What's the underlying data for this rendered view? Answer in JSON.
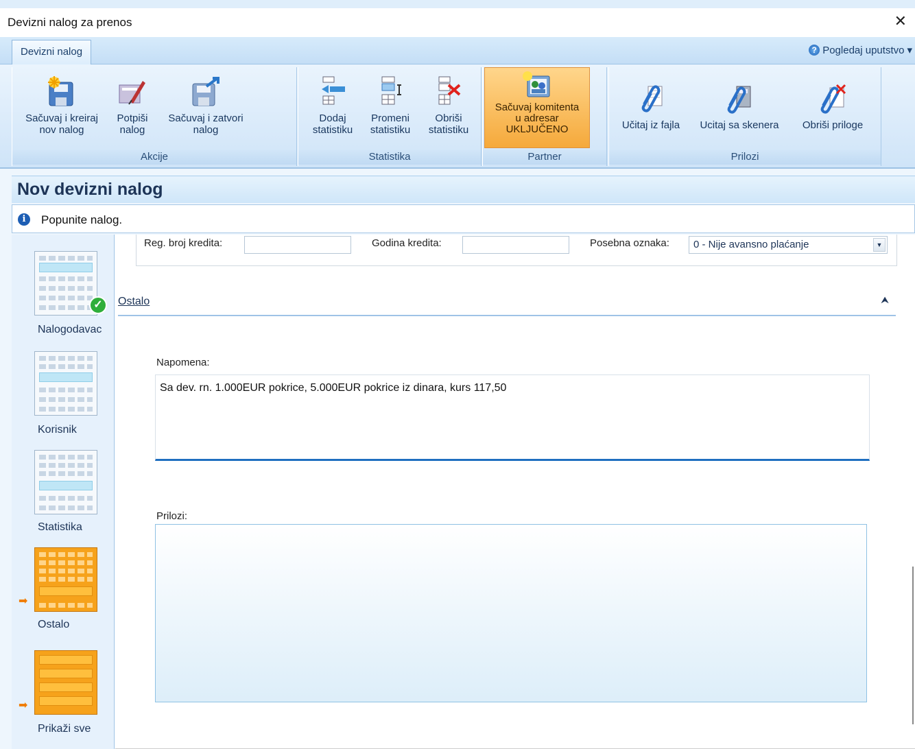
{
  "window": {
    "title": "Devizni nalog za prenos",
    "close": "✕"
  },
  "ribbon_tabs": {
    "active": "Devizni nalog",
    "help": "Pogledaj uputstvo",
    "help_caret": "▾"
  },
  "ribbon": {
    "groups": {
      "akcije": "Akcije",
      "statistika": "Statistika",
      "partner": "Partner",
      "prilozi": "Prilozi"
    },
    "buttons": {
      "save_new": [
        "Sačuvaj i kreiraj",
        "nov nalog"
      ],
      "sign": [
        "Potpiši",
        "nalog"
      ],
      "save_close": [
        "Sačuvaj i zatvori",
        "nalog"
      ],
      "add_stat": [
        "Dodaj",
        "statistiku"
      ],
      "change_stat": [
        "Promeni",
        "statistiku"
      ],
      "delete_stat": [
        "Obriši",
        "statistiku"
      ],
      "save_client": [
        "Sačuvaj komitenta",
        "u adresar",
        "UKLJUČENO"
      ],
      "load_file": "Učitaj iz fajla",
      "load_scanner": "Ucitaj sa skenera",
      "delete_attachments": "Obriši priloge"
    },
    "colors": {
      "accent": "#f5a93b",
      "ribbon_bg": "#cfe4f8"
    }
  },
  "page": {
    "title": "Nov devizni nalog",
    "info": "Popunite nalog."
  },
  "nav": {
    "items": [
      {
        "label": "Nalogodavac",
        "completed": true
      },
      {
        "label": "Korisnik"
      },
      {
        "label": "Statistika"
      },
      {
        "label": "Ostalo",
        "current": true
      },
      {
        "label": "Prikaži sve"
      }
    ],
    "check_glyph": "✓",
    "arrow_glyph": "➡"
  },
  "form": {
    "reg_label": "Reg. broj kredita:",
    "godina_label": "Godina kredita:",
    "posebna_label": "Posebna oznaka:",
    "posebna_value": "0 - Nije avansno plaćanje",
    "combo_caret": "▼",
    "section_title": "Ostalo",
    "collapse_glyph": "⮝",
    "napomena_label": "Napomena:",
    "napomena_value": "Sa dev. rn. 1.000EUR pokrice, 5.000EUR pokrice iz dinara, kurs 117,50",
    "prilozi_label": "Prilozi:"
  },
  "icons": [
    "save-new-icon",
    "sign-icon",
    "save-close-icon",
    "add-stat-icon",
    "change-stat-icon",
    "delete-stat-icon",
    "address-book-icon",
    "paperclip-icon",
    "scanner-icon",
    "delete-clip-icon",
    "help-icon",
    "info-icon"
  ]
}
